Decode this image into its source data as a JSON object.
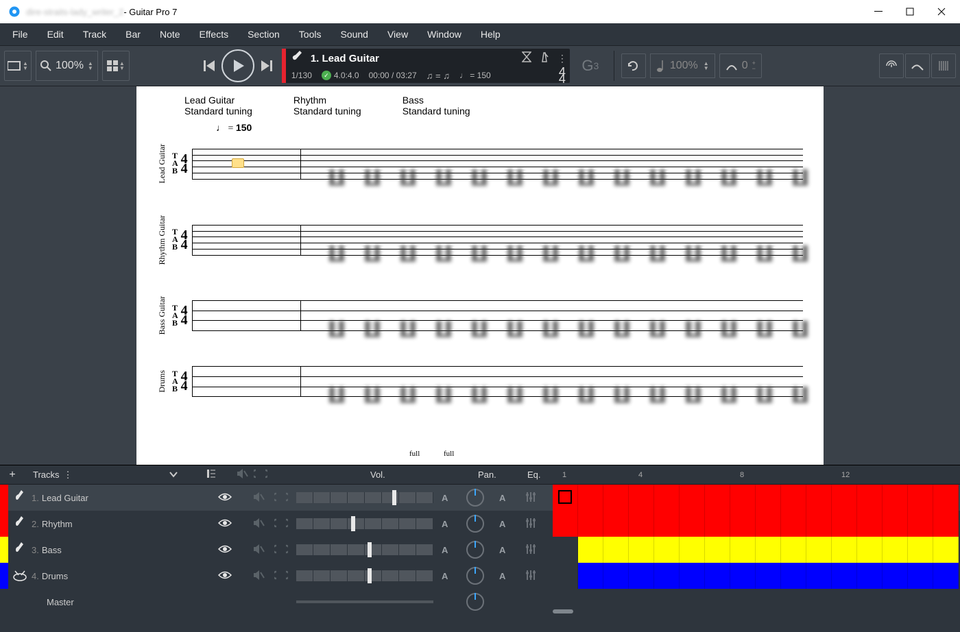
{
  "titlebar": {
    "document_name": "dire-straits-lady_writer_2",
    "app_name": " - Guitar Pro 7"
  },
  "menu": [
    "File",
    "Edit",
    "Track",
    "Bar",
    "Note",
    "Effects",
    "Section",
    "Tools",
    "Sound",
    "View",
    "Window",
    "Help"
  ],
  "toolbar": {
    "zoom": "100%",
    "track_name": "1. Lead Guitar",
    "bar_pos": "1/130",
    "beat_pos": "4.0:4.0",
    "time": "00:00 / 03:27",
    "tempo_label": "♩ = ",
    "tempo_value": "150",
    "time_sig_top": "4",
    "time_sig_bot": "4",
    "chord": "G",
    "chord_sub": "3",
    "note_zoom": "100%",
    "tuner_value": "0"
  },
  "score": {
    "instruments": [
      {
        "name": "Lead Guitar",
        "tuning": "Standard tuning"
      },
      {
        "name": "Rhythm",
        "tuning": "Standard tuning"
      },
      {
        "name": "Bass",
        "tuning": "Standard tuning"
      }
    ],
    "tempo": "♩ = 150",
    "tempo_bold": "150",
    "staves": [
      {
        "label": "Lead Guitar",
        "lines": 6
      },
      {
        "label": "Rhythm Guitar",
        "lines": 6
      },
      {
        "label": "Bass Guitar",
        "lines": 4
      },
      {
        "label": "Drums",
        "lines": 4
      }
    ],
    "full_label": "full"
  },
  "tracks_panel": {
    "header": {
      "title": "Tracks",
      "vol": "Vol.",
      "pan": "Pan.",
      "eq": "Eq."
    },
    "ruler": [
      "1",
      "",
      "",
      "4",
      "",
      "",
      "",
      "8",
      "",
      "",
      "",
      "12",
      "",
      ""
    ],
    "rows": [
      {
        "color": "#ff0000",
        "num": "1.",
        "name": "Lead Guitar",
        "vol": 70,
        "selected": true,
        "timeline_color": "#ff0000",
        "cursor": true
      },
      {
        "color": "#ff0000",
        "num": "2.",
        "name": "Rhythm",
        "vol": 40,
        "selected": false,
        "timeline_color": "#ff0000"
      },
      {
        "color": "#ffff00",
        "num": "3.",
        "name": "Bass",
        "vol": 52,
        "selected": false,
        "timeline_color": "#ffff00",
        "offset": 1
      },
      {
        "color": "#0000ff",
        "num": "4.",
        "name": "Drums",
        "vol": 52,
        "selected": false,
        "timeline_color": "#0000ff",
        "offset": 1
      }
    ],
    "master": "Master"
  }
}
